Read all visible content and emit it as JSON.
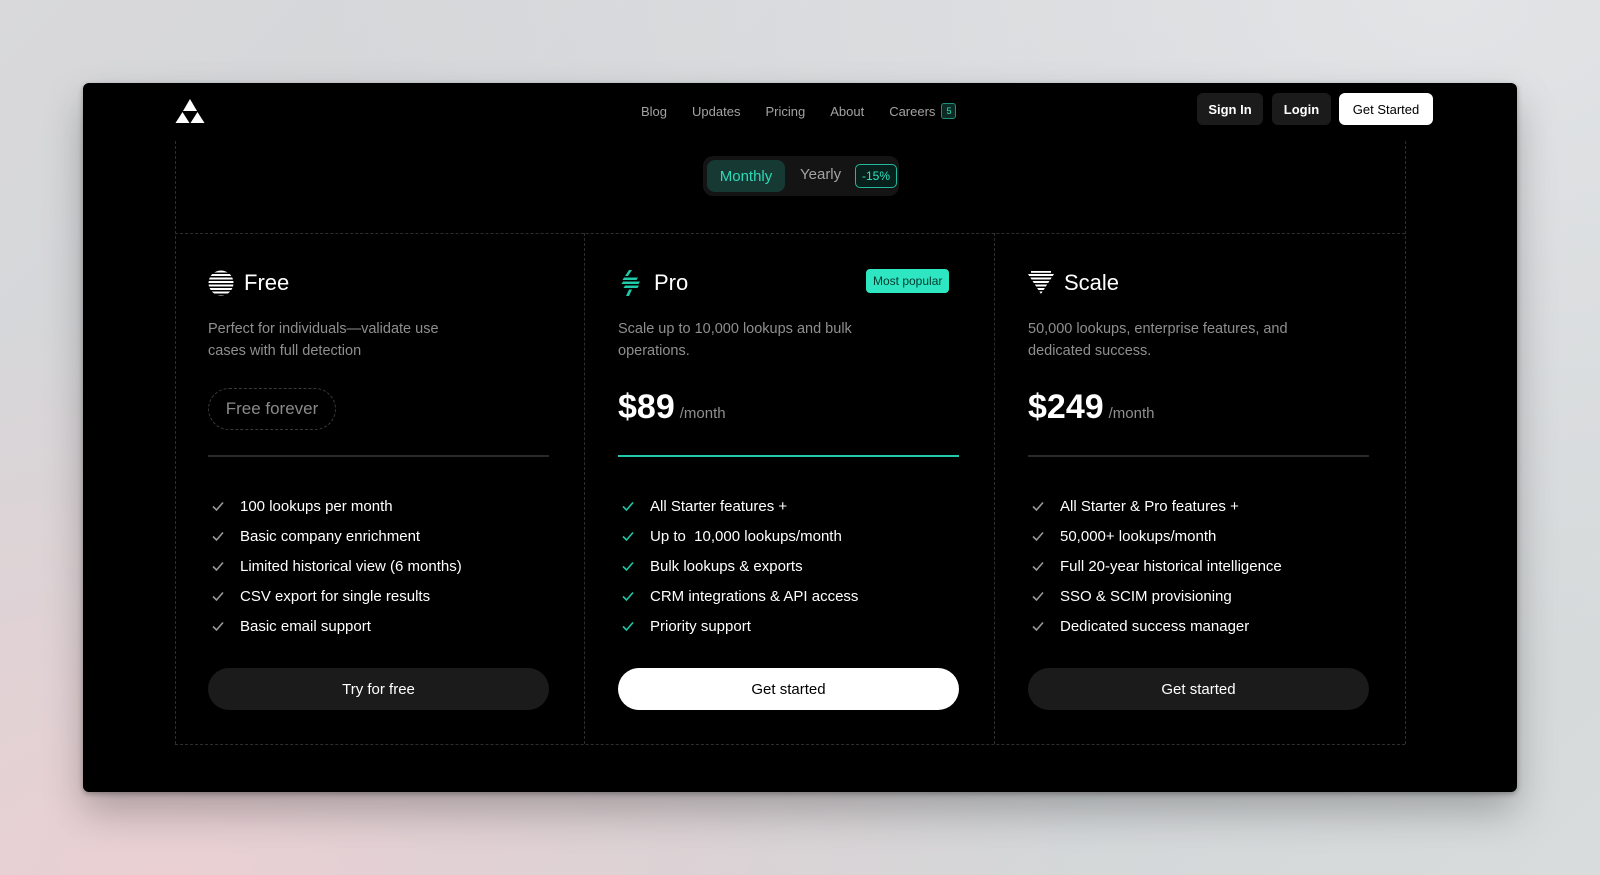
{
  "nav": {
    "links": [
      {
        "label": "Blog"
      },
      {
        "label": "Updates"
      },
      {
        "label": "Pricing"
      },
      {
        "label": "About"
      },
      {
        "label": "Careers",
        "badge": "5"
      }
    ],
    "sign_in": "Sign In",
    "login": "Login",
    "get_started": "Get Started"
  },
  "billing_toggle": {
    "monthly": "Monthly",
    "yearly": "Yearly",
    "discount": "-15%",
    "selected": "Monthly"
  },
  "plans": [
    {
      "icon": "striped-circle-icon",
      "name": "Free",
      "description": "Perfect for individuals—validate use cases with full detection",
      "price_text": "Free forever",
      "features": [
        "100 lookups per month",
        "Basic company enrichment",
        "Limited historical view (6 months)",
        "CSV export for single results",
        "Basic email support"
      ],
      "cta": "Try for free"
    },
    {
      "icon": "striped-bolt-icon",
      "name": "Pro",
      "badge": "Most popular",
      "description": "Scale up to 10,000 lookups and bulk operations.",
      "price": "$89",
      "per": "/month",
      "features": [
        "All Starter features +",
        "Up to  10,000 lookups/month",
        "Bulk lookups & exports",
        "CRM integrations & API access",
        "Priority support"
      ],
      "cta": "Get started"
    },
    {
      "icon": "striped-diamond-icon",
      "name": "Scale",
      "description": "50,000 lookups, enterprise features, and dedicated success.",
      "price": "$249",
      "per": "/month",
      "features": [
        "All Starter & Pro features +",
        "50,000+ lookups/month",
        "Full 20-year historical intelligence",
        "SSO & SCIM provisioning",
        "Dedicated success manager"
      ],
      "cta": "Get started"
    }
  ],
  "colors": {
    "accent": "#2ee6c2",
    "background": "#000000",
    "button_dark": "#1b1b1b"
  }
}
